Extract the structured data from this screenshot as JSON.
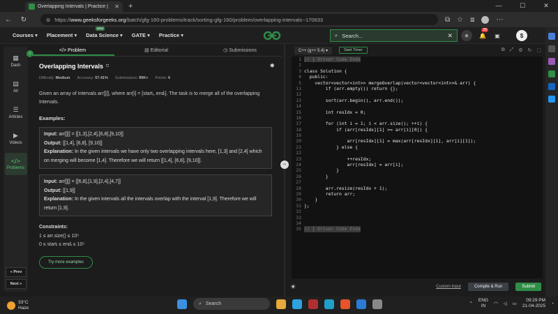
{
  "browser": {
    "tab_title": "Overlapping Intervals | Practice |",
    "url_domain": "www.geeksforgeeks.org",
    "url_path": "/batch/gfg-160-problems/track/sorting-gfg-160/problem/overlapping-intervals--170633",
    "url_prefix": "https://"
  },
  "gfg_nav": {
    "items": [
      "Courses ▾",
      "Placement ▾",
      "Data Science ▾",
      "GATE ▾",
      "Practice ▾"
    ],
    "new_badge": "NEW",
    "search_placeholder": "Search...",
    "notif_count": "39",
    "accent": "#2f8d46"
  },
  "sidebar": {
    "items": [
      {
        "label": "Dash",
        "icon": "dashboard-icon"
      },
      {
        "label": "All",
        "icon": "grid-icon"
      },
      {
        "label": "Articles",
        "icon": "article-icon"
      },
      {
        "label": "Videos",
        "icon": "video-icon"
      },
      {
        "label": "Problems",
        "icon": "code-icon"
      }
    ],
    "prev": "« Prev",
    "next": "Next »"
  },
  "left_tabs": [
    "Problem",
    "Editorial",
    "Submissions"
  ],
  "problem": {
    "title": "Overlapping Intervals",
    "difficulty_label": "Difficulty:",
    "difficulty": "Medium",
    "accuracy_label": "Accuracy:",
    "accuracy": "57.41%",
    "submissions_label": "Submissions:",
    "submissions": "99K+",
    "points_label": "Points:",
    "points": "4",
    "statement": "Given an array of Intervals arr[][], where arr[i] = [startᵢ, endᵢ]. The task is to merge all of the overlapping Intervals.",
    "examples_heading": "Examples:",
    "examples": [
      {
        "input_label": "Input:",
        "input": "arr[][] = [[1,3],[2,4],[6,8],[9,10]]",
        "output_label": "Output:",
        "output": "[[1,4], [6,8], [9,10]]",
        "expl_label": "Explanation:",
        "explanation": "In the given intervals we have only two overlapping intervals here, [1,3] and [2,4] which on merging will become [1,4]. Therefore we will return [[1,4], [6,8], [9,10]]."
      },
      {
        "input_label": "Input:",
        "input": "arr[][] = [[6,8],[1,9],[2,4],[4,7]]",
        "output_label": "Output:",
        "output": "[[1,9]]",
        "expl_label": "Explanation:",
        "explanation": "In the given intervals all the intervals overlap with the interval [1,9]. Therefore we will return [1,9]."
      }
    ],
    "constraints_heading": "Constraints:",
    "constraints": [
      "1 ≤ arr.size() ≤ 10⁵",
      "0 ≤ startᵢ ≤ endᵢ ≤ 10⁵"
    ],
    "try_more": "Try more examples"
  },
  "editor": {
    "language": "C++ (g++ 5.4) ▾",
    "start_timer": "Start Timer",
    "lines": [
      {
        "n": "1",
        "t": "// } Driver Code Ends",
        "c": true
      },
      {
        "n": "2",
        "t": ""
      },
      {
        "n": "3",
        "t": "class Solution {"
      },
      {
        "n": "4",
        "t": "  public:"
      },
      {
        "n": "5",
        "t": "    vector<vector<int>> mergeOverlap(vector<vector<int>>& arr) {"
      },
      {
        "n": "11",
        "t": "        if (arr.empty()) return {};"
      },
      {
        "n": "12",
        "t": ""
      },
      {
        "n": "13",
        "t": "        sort(arr.begin(), arr.end());"
      },
      {
        "n": "14",
        "t": ""
      },
      {
        "n": "15",
        "t": "        int resIdx = 0;"
      },
      {
        "n": "16",
        "t": ""
      },
      {
        "n": "17",
        "t": "        for (int i = 1; i < arr.size(); ++i) {"
      },
      {
        "n": "18",
        "t": "            if (arr[resIdx][1] >= arr[i][0]) {"
      },
      {
        "n": "19",
        "t": ""
      },
      {
        "n": "20",
        "t": "                arr[resIdx][1] = max(arr[resIdx][1], arr[i][1]);"
      },
      {
        "n": "21",
        "t": "            } else {"
      },
      {
        "n": "22",
        "t": ""
      },
      {
        "n": "23",
        "t": "                ++resIdx;"
      },
      {
        "n": "24",
        "t": "                arr[resIdx] = arr[i];"
      },
      {
        "n": "25",
        "t": "            }"
      },
      {
        "n": "26",
        "t": "        }"
      },
      {
        "n": "27",
        "t": ""
      },
      {
        "n": "28",
        "t": "        arr.resize(resIdx + 1);"
      },
      {
        "n": "29",
        "t": "        return arr;"
      },
      {
        "n": "30",
        "t": "    }"
      },
      {
        "n": "31",
        "t": "};"
      },
      {
        "n": "32",
        "t": ""
      },
      {
        "n": "33",
        "t": ""
      },
      {
        "n": "34",
        "t": ""
      },
      {
        "n": "35",
        "t": "// } Driver Code Ends",
        "c": true
      }
    ],
    "custom_input": "Custom Input",
    "compile_run": "Compile & Run",
    "submit": "Submit"
  },
  "taskbar": {
    "temp": "33°C",
    "weather": "Haze",
    "search": "Search",
    "lang": "ENG",
    "region": "IN",
    "time": "09:29 PM",
    "date": "21-04-2025"
  }
}
